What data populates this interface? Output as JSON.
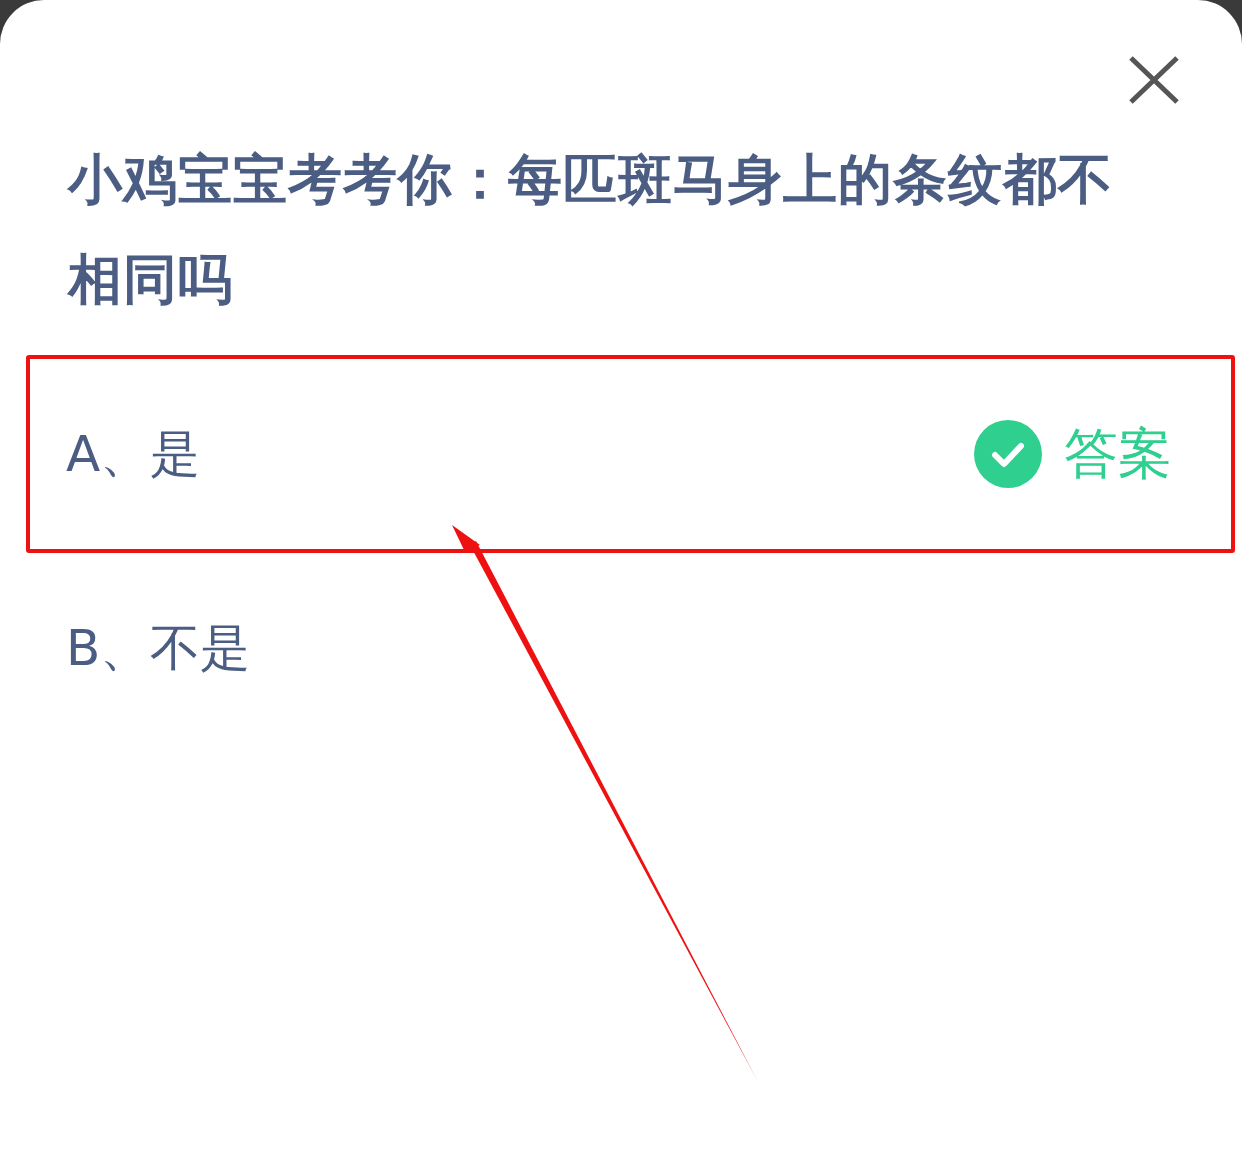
{
  "question": "小鸡宝宝考考你：每匹斑马身上的条纹都不相同吗",
  "options": [
    {
      "label": "A、是",
      "correct": true,
      "answer_label": "答案",
      "highlighted": true
    },
    {
      "label": "B、不是",
      "correct": false,
      "highlighted": false
    }
  ]
}
